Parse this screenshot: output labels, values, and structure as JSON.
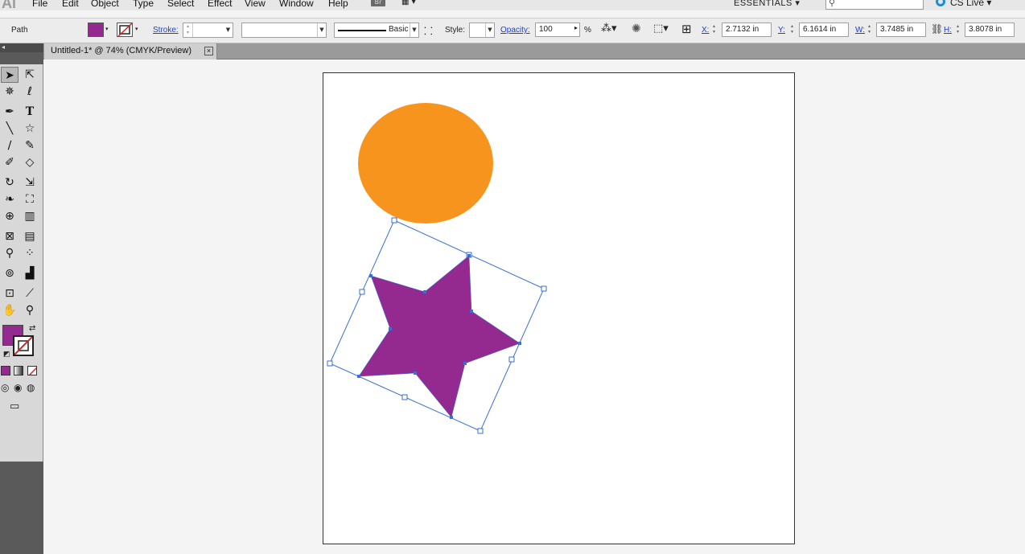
{
  "app": {
    "logo": "Ai",
    "menus": [
      "File",
      "Edit",
      "Object",
      "Type",
      "Select",
      "Effect",
      "View",
      "Window",
      "Help"
    ],
    "bridge_label": "Br",
    "workspace": "ESSENTIALS ▾",
    "search_placeholder": "",
    "cs_live": "CS Live ▾"
  },
  "control_bar": {
    "selection_type": "Path",
    "fill_color": "#942a8f",
    "stroke_label": "Stroke:",
    "stroke_weight": "",
    "brush": "",
    "stroke_profile": "Basic",
    "style_label": "Style:",
    "opacity_label": "Opacity:",
    "opacity_value": "100",
    "opacity_unit": "%",
    "x_label": "X:",
    "x_value": "2.7132 in",
    "y_label": "Y:",
    "y_value": "6.1614 in",
    "w_label": "W:",
    "w_value": "3.7485 in",
    "h_label": "H:",
    "h_value": "3.8078 in"
  },
  "document": {
    "tab_title": "Untitled-1* @ 74% (CMYK/Preview)",
    "close": "×"
  },
  "toolbox": {
    "fill_color": "#942a8f"
  },
  "artwork": {
    "ellipse_color": "#f7941d",
    "star_color": "#942a8f",
    "selection_color": "#3a6fd8"
  }
}
